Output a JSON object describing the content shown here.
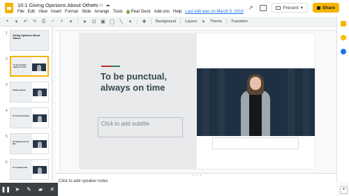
{
  "app": {
    "doc_title": "10:1 Giving Opinions About Others",
    "menu": [
      "File",
      "Edit",
      "View",
      "Insert",
      "Format",
      "Slide",
      "Arrange",
      "Tools"
    ],
    "addon_label": "Pear Deck",
    "menu_after": [
      "Add-ons",
      "Help"
    ],
    "last_edit": "Last edit was on March 5, 2019"
  },
  "header": {
    "present_label": "Present",
    "share_label": "Share",
    "share_color": "#f4b400"
  },
  "toolbar": {
    "background_label": "Background",
    "layout_label": "Layout",
    "theme_label": "Theme",
    "transition_label": "Transition"
  },
  "filmstrip": {
    "slides": [
      {
        "number": "1",
        "title": "Giving Opinions About Others",
        "kind": "cover"
      },
      {
        "number": "2",
        "title": "To be punctual, always on time",
        "kind": "video"
      },
      {
        "number": "3",
        "title": "Stating opinion",
        "kind": "video"
      },
      {
        "number": "4",
        "title": "To be hard working",
        "kind": "video"
      },
      {
        "number": "5",
        "title": "To always/never be late",
        "kind": "video"
      },
      {
        "number": "6",
        "title": "To be always late",
        "kind": "video"
      }
    ],
    "selected_index": 1
  },
  "slide": {
    "title": "To be punctual, always on time",
    "subtitle_placeholder": "Click to add subtitle",
    "accent_colors": [
      "#c62828",
      "#2e7d5b"
    ]
  },
  "notes": {
    "placeholder": "Click to add speaker notes"
  },
  "annotation_bar": {
    "icons": [
      "pause-icon",
      "pointer-icon",
      "pen-icon",
      "highlighter-icon",
      "close-icon"
    ]
  }
}
